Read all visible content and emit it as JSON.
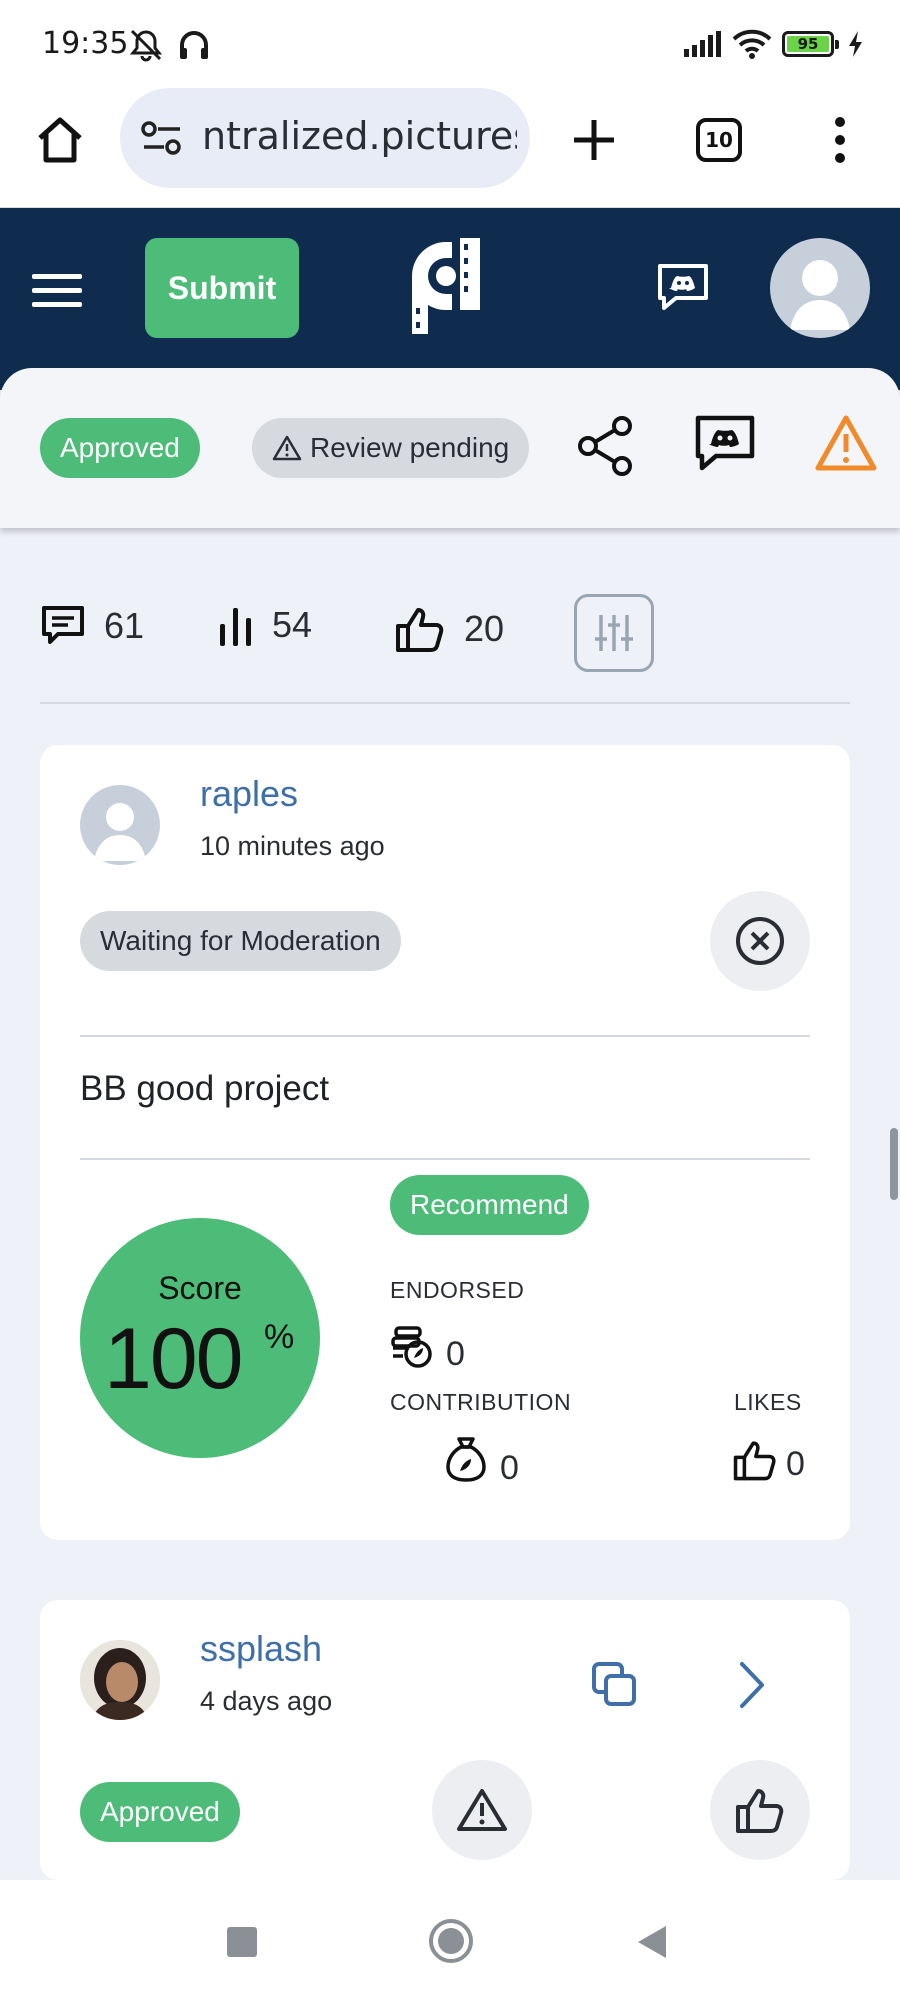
{
  "status_bar": {
    "time": "19:35",
    "battery": "95",
    "icons": [
      "mute-icon",
      "headphones-icon",
      "signal-icon",
      "wifi-icon",
      "battery-icon",
      "charging-icon"
    ]
  },
  "browser": {
    "url": "ntralized.pictures",
    "tab_count": "10"
  },
  "header": {
    "submit_label": "Submit"
  },
  "status_row": {
    "approved_label": "Approved",
    "review_label": "Review pending"
  },
  "stats": {
    "comments": "61",
    "views": "54",
    "likes": "20"
  },
  "reviews": [
    {
      "username": "raples",
      "time": "10 minutes ago",
      "status": "Waiting for Moderation",
      "comment": "BB good project",
      "score_label": "Score",
      "score_value": "100",
      "score_unit": "%",
      "recommend_label": "Recommend",
      "endorsed_label": "ENDORSED",
      "endorsed_value": "0",
      "contribution_label": "CONTRIBUTION",
      "contribution_value": "0",
      "likes_label": "LIKES",
      "likes_value": "0"
    },
    {
      "username": "ssplash",
      "time": "4 days ago",
      "status": "Approved"
    }
  ],
  "colors": {
    "header_bg": "#0f2c4f",
    "green": "#4cbc78",
    "link_blue": "#3e6fa8",
    "warning_orange": "#f08a2a"
  }
}
